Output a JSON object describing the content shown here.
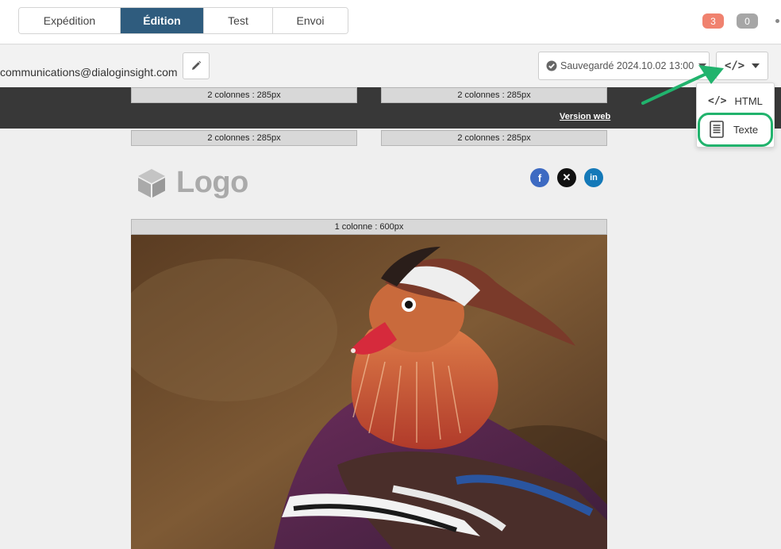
{
  "tabs": [
    {
      "label": "Expédition",
      "active": false
    },
    {
      "label": "Édition",
      "active": true
    },
    {
      "label": "Test",
      "active": false
    },
    {
      "label": "Envoi",
      "active": false
    }
  ],
  "badges": {
    "red": "3",
    "grey": "0"
  },
  "sender_email": "communications@dialoginsight.com",
  "save_status": "Sauvegardé 2024.10.02 13:00",
  "code_button_label": "</>",
  "menu": {
    "html_label": "HTML",
    "text_label": "Texte"
  },
  "email": {
    "col2_labels": [
      "2 colonnes : 285px",
      "2 colonnes : 285px",
      "2 colonnes : 285px",
      "2 colonnes : 285px"
    ],
    "version_web": "Version web",
    "logo_text": "Logo",
    "col1_label": "1 colonne : 600px",
    "social": [
      "facebook-icon",
      "x-icon",
      "linkedin-icon"
    ]
  },
  "colors": {
    "active_tab": "#2f5c7e",
    "accent_green": "#21b36d",
    "badge_red": "#f0826f",
    "badge_grey": "#a6a6a6"
  }
}
